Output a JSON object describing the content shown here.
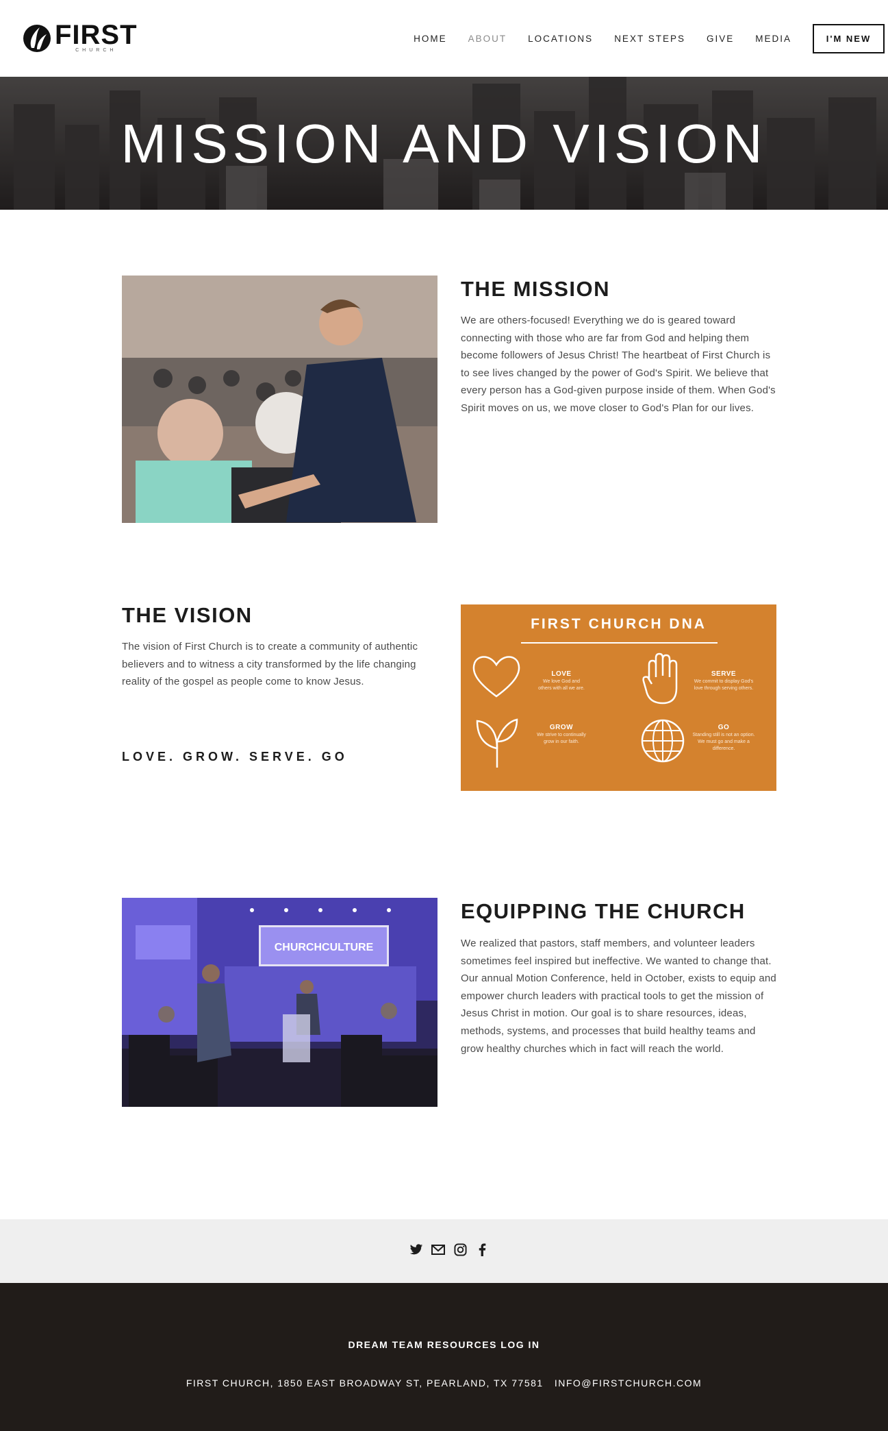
{
  "header": {
    "logo_word": "FIRST",
    "logo_sub": "CHURCH",
    "nav": [
      {
        "label": "HOME",
        "active": false
      },
      {
        "label": "ABOUT",
        "active": true
      },
      {
        "label": "LOCATIONS",
        "active": false
      },
      {
        "label": "NEXT STEPS",
        "active": false
      },
      {
        "label": "GIVE",
        "active": false
      },
      {
        "label": "MEDIA",
        "active": false
      }
    ],
    "cta": "I'M NEW"
  },
  "hero": {
    "title": "MISSION AND VISION"
  },
  "mission": {
    "title": "THE MISSION",
    "body": "We are others-focused! Everything we do is geared toward connecting with those who are far from God and helping them become followers of Jesus Christ!  The heartbeat of First Church is to see lives changed by the power of God's Spirit. We believe that every person has a God-given purpose inside of them. When God's Spirit moves on us, we move closer to God's Plan for our lives."
  },
  "vision": {
    "title": "THE VISION",
    "body": "The vision of First Church is to create a community of authentic believers and to witness a city transformed by the life changing reality of the gospel as people come to know Jesus.",
    "tagline": "LOVE. GROW. SERVE. GO"
  },
  "dna": {
    "title": "FIRST CHURCH DNA",
    "items": [
      {
        "label": "LOVE",
        "desc": "We love God and others with all we are."
      },
      {
        "label": "SERVE",
        "desc": "We commit to display God's love through serving others."
      },
      {
        "label": "GROW",
        "desc": "We strive to continually grow in our faith."
      },
      {
        "label": "GO",
        "desc": "Standing still is not an option. We must go and make a difference."
      }
    ],
    "color": "#d4822e"
  },
  "equipping": {
    "title": "EQUIPPING THE CHURCH",
    "body": "We realized that pastors, staff members, and volunteer leaders sometimes feel inspired but ineffective. We wanted to change that. Our annual Motion Conference, held in October, exists to equip and empower church leaders with practical tools to get the mission of Jesus Christ in motion. Our goal is to share resources, ideas, methods, systems, and processes that build healthy teams and grow healthy churches which in fact will reach the world.",
    "screen_text": "CHURCHCULTURE"
  },
  "social": [
    "twitter-icon",
    "email-icon",
    "instagram-icon",
    "facebook-icon"
  ],
  "footer": {
    "link": "DREAM TEAM RESOURCES LOG IN",
    "address": "FIRST CHURCH, 1850 EAST BROADWAY ST, PEARLAND, TX 77581   INFO@FIRSTCHURCH.COM"
  }
}
